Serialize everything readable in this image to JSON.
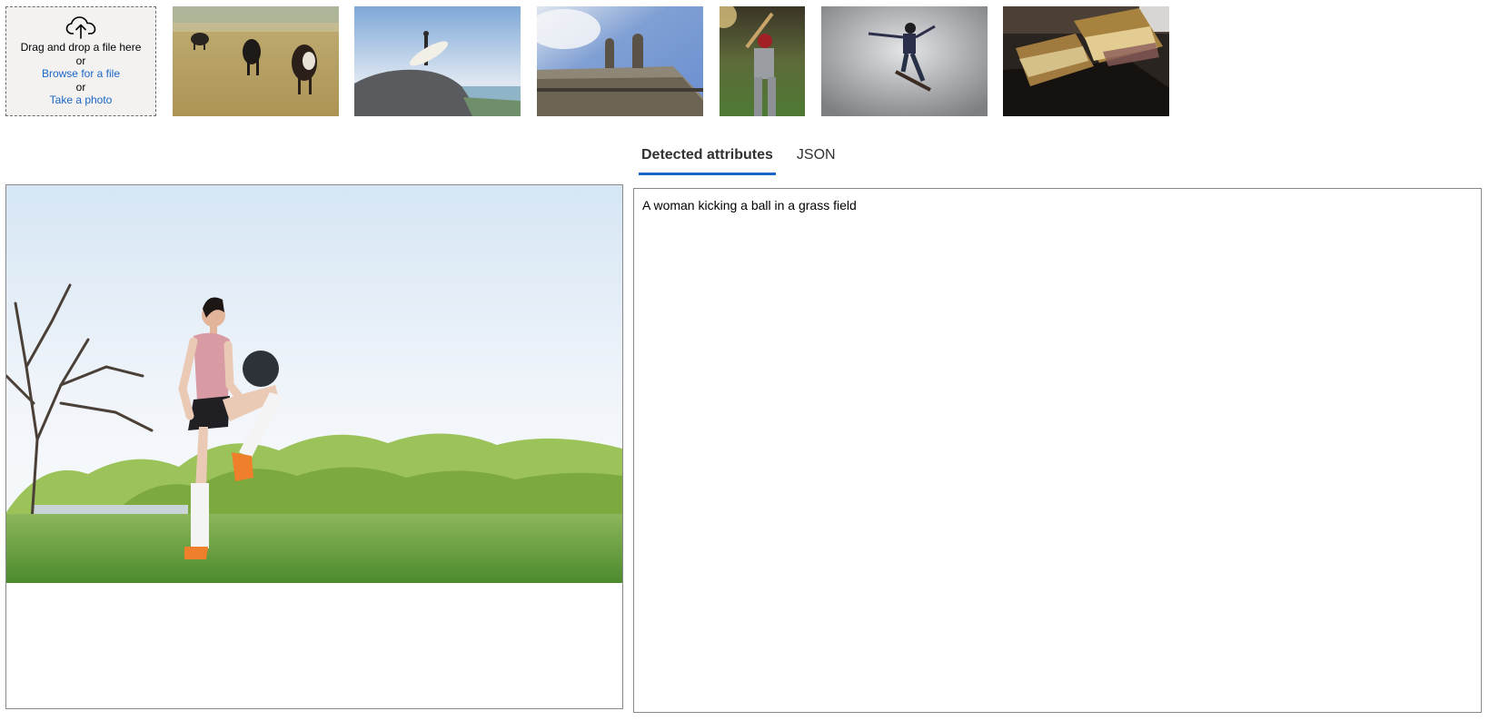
{
  "upload": {
    "drag_text": "Drag and drop a file here",
    "or_1": "or",
    "browse_link": "Browse for a file",
    "or_2": "or",
    "photo_link": "Take a photo",
    "icon": "cloud-upload-icon"
  },
  "thumbnails": [
    {
      "name": "cows-in-field",
      "icon": "image-thumbnail"
    },
    {
      "name": "surfer-on-rock",
      "icon": "image-thumbnail"
    },
    {
      "name": "building-statue",
      "icon": "image-thumbnail"
    },
    {
      "name": "baseball-batter",
      "icon": "image-thumbnail"
    },
    {
      "name": "skateboarder",
      "icon": "image-thumbnail"
    },
    {
      "name": "sandwich",
      "icon": "image-thumbnail"
    }
  ],
  "tabs": [
    {
      "label": "Detected attributes",
      "active": true
    },
    {
      "label": "JSON",
      "active": false
    }
  ],
  "results": {
    "caption": "A woman kicking a ball in a grass field"
  },
  "colors": {
    "accent": "#1a66c6",
    "dropzone_bg": "#f3f2f1",
    "border": "#8a8886"
  }
}
